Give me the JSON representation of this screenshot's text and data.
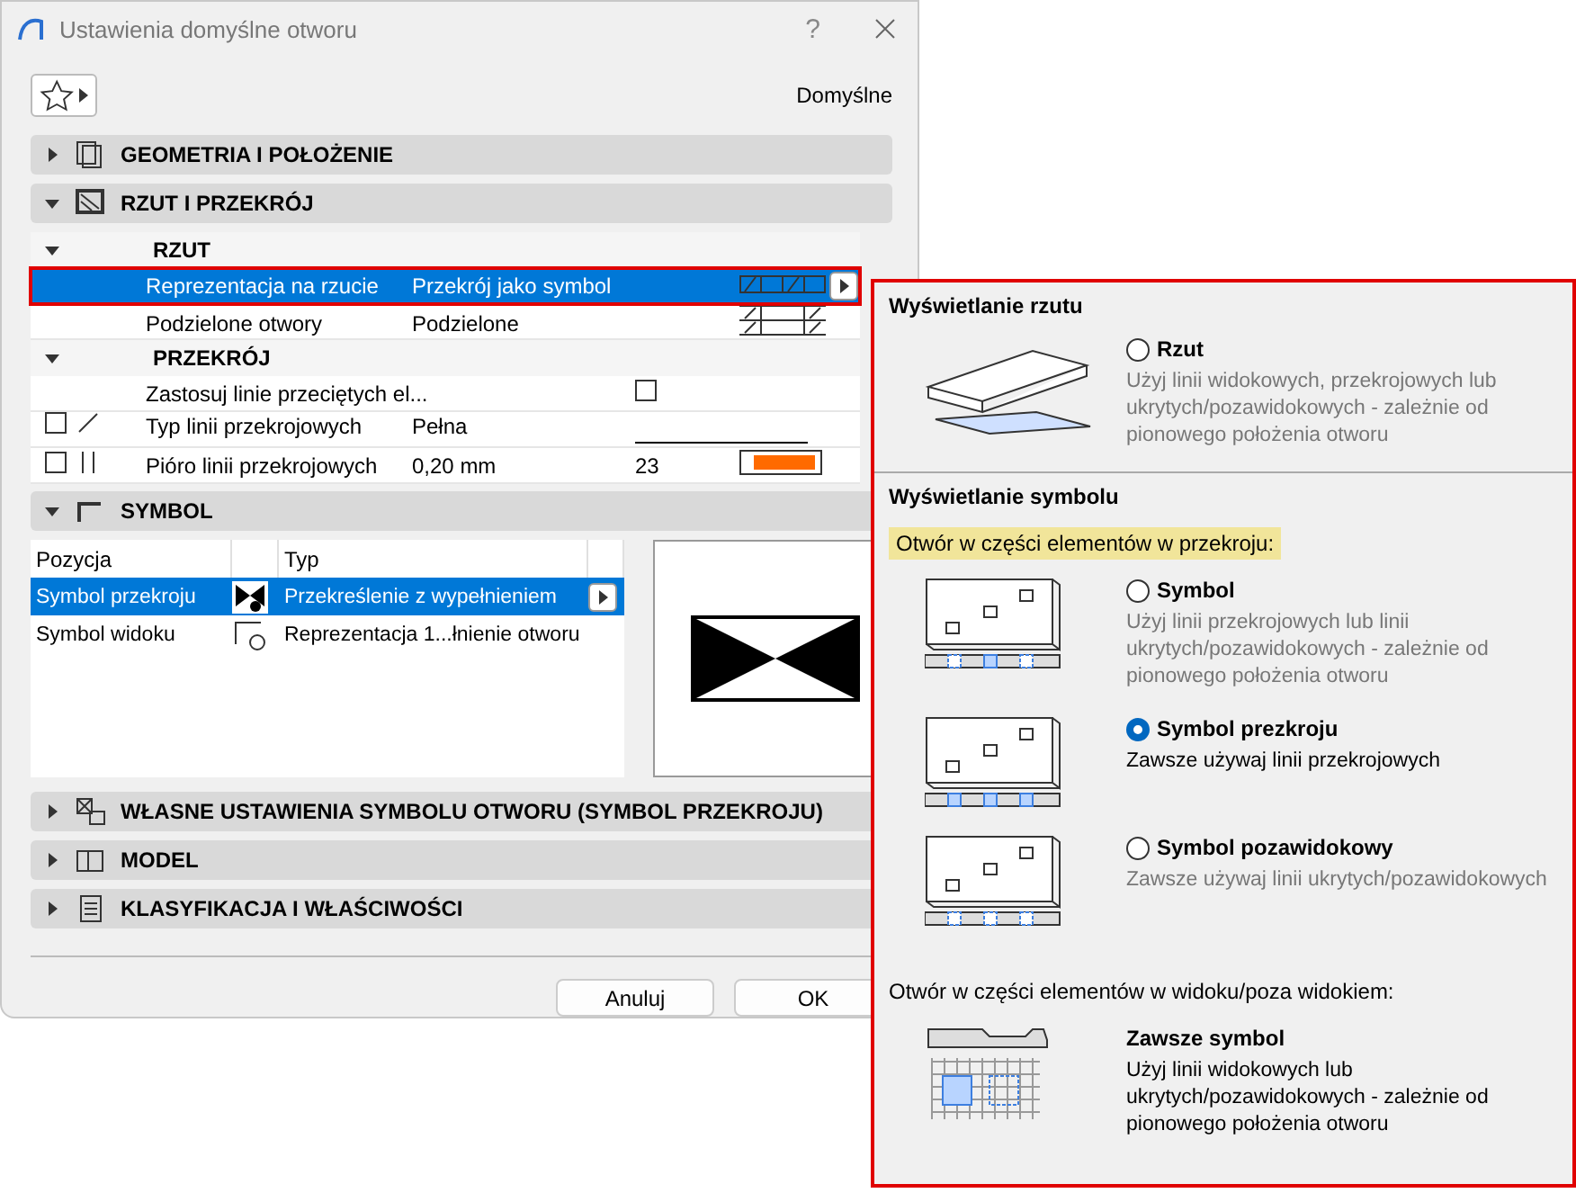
{
  "window": {
    "title": "Ustawienia domyślne otworu",
    "help": "?"
  },
  "favorites_label": "Domyślne",
  "geometry_section": {
    "title": "GEOMETRIA I POŁOŻENIE",
    "expanded": false
  },
  "plan_section": {
    "title": "RZUT I PRZEKRÓJ",
    "expanded": true,
    "groups": [
      {
        "title": "RZUT",
        "expanded": true,
        "rows": [
          {
            "kind": "plan",
            "label": "Reprezentacja na rzucie",
            "value": "Przekrój jako symbol",
            "selected": true
          },
          {
            "kind": "split",
            "label": "Podzielone otwory",
            "value": "Podzielone",
            "selected": false
          }
        ]
      },
      {
        "title": "PRZEKRÓJ",
        "expanded": true,
        "rows": [
          {
            "kind": "checkbox",
            "label": "Zastosuj linie przeciętych el...",
            "checked": false,
            "selected": false
          },
          {
            "kind": "line",
            "label": "Typ linii przekrojowych",
            "value": "Pełna",
            "override": false,
            "selected": false
          },
          {
            "kind": "pen",
            "label": "Pióro linii przekrojowych",
            "value": "0,20 mm",
            "number": "23",
            "override": false,
            "selected": false
          }
        ]
      }
    ]
  },
  "symbol_section": {
    "title": "SYMBOL",
    "expanded": true,
    "columns": [
      "Pozycja",
      "Typ"
    ],
    "rows": [
      {
        "kind": "cut",
        "position": "Symbol przekroju",
        "type": "Przekreślenie z wypełnieniem",
        "selected": true
      },
      {
        "kind": "view",
        "position": "Symbol widoku",
        "type": "Reprezentacja 1...łnienie otworu",
        "selected": false
      }
    ]
  },
  "collapsed_sections": [
    {
      "kind": "custom",
      "title": "WŁASNE USTAWIENIA SYMBOLU OTWORU (SYMBOL PRZEKROJU)",
      "expanded": false
    },
    {
      "kind": "model",
      "title": "MODEL",
      "expanded": false
    },
    {
      "kind": "classification",
      "title": "KLASYFIKACJA I WŁAŚCIWOŚCI",
      "expanded": false
    }
  ],
  "buttons": [
    "Anuluj",
    "OK"
  ],
  "popup": {
    "plan_display": {
      "title": "Wyświetlanie rzutu",
      "options": [
        {
          "label": "Rzut",
          "description": "Użyj linii widokowych, przekrojowych lub ukrytych/pozawidokowych - zależnie od pionowego położenia otworu",
          "selected": false
        }
      ]
    },
    "symbol_display": {
      "title": "Wyświetlanie symbolu",
      "cut_heading": "Otwór w części elementów w przekroju:",
      "cut_options": [
        {
          "kind": "symbol",
          "label": "Symbol",
          "description": "Użyj linii przekrojowych lub linii ukrytych/pozawidokowych - zależnie od pionowego położenia otworu",
          "selected": false
        },
        {
          "kind": "cut",
          "label": "Symbol prezkroju",
          "description": "Zawsze używaj linii przekrojowych",
          "selected": true
        },
        {
          "kind": "hidden",
          "label": "Symbol pozawidokowy",
          "description": "Zawsze używaj linii ukrytych/pozawidokowych",
          "selected": false
        }
      ],
      "view_heading": "Otwór w części elementów w widoku/poza widokiem:",
      "view_option": {
        "label": "Zawsze symbol",
        "description": "Użyj linii widokowych lub ukrytych/pozawidokowych - zależnie od pionowego położenia otworu"
      }
    }
  }
}
